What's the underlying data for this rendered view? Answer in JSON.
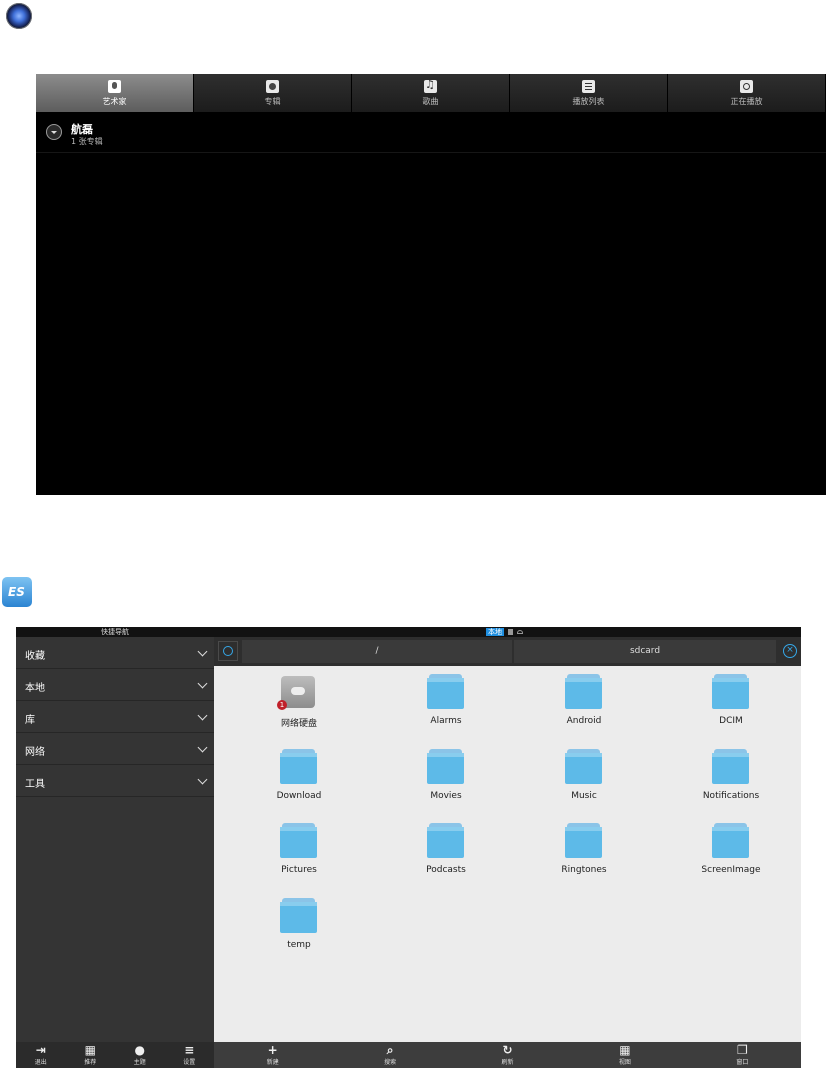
{
  "music_player": {
    "tabs": [
      {
        "label": "艺术家",
        "icon": "mic-icon",
        "active": true
      },
      {
        "label": "专辑",
        "icon": "album-icon"
      },
      {
        "label": "歌曲",
        "icon": "note-icon"
      },
      {
        "label": "播放列表",
        "icon": "list-icon"
      },
      {
        "label": "正在播放",
        "icon": "nowplaying-icon"
      }
    ],
    "artist": {
      "name": "航磊",
      "subtitle": "1 张专辑"
    }
  },
  "file_explorer": {
    "quicknav_title": "快捷导航",
    "status_local": "本地",
    "sidebar": [
      {
        "label": "收藏"
      },
      {
        "label": "本地"
      },
      {
        "label": "库"
      },
      {
        "label": "网络"
      },
      {
        "label": "工具"
      }
    ],
    "path": {
      "root": "/",
      "current": "sdcard"
    },
    "files": [
      {
        "name": "网络硬盘",
        "type": "cloud",
        "badge": "1"
      },
      {
        "name": "Alarms",
        "type": "folder"
      },
      {
        "name": "Android",
        "type": "folder"
      },
      {
        "name": "DCIM",
        "type": "folder"
      },
      {
        "name": "Download",
        "type": "folder"
      },
      {
        "name": "Movies",
        "type": "folder"
      },
      {
        "name": "Music",
        "type": "folder"
      },
      {
        "name": "Notifications",
        "type": "folder"
      },
      {
        "name": "Pictures",
        "type": "folder"
      },
      {
        "name": "Podcasts",
        "type": "folder"
      },
      {
        "name": "Ringtones",
        "type": "folder"
      },
      {
        "name": "ScreenImage",
        "type": "folder"
      },
      {
        "name": "temp",
        "type": "folder"
      }
    ],
    "side_toolbar": [
      {
        "label": "退出",
        "icon": "exit-icon"
      },
      {
        "label": "推荐",
        "icon": "gift-icon"
      },
      {
        "label": "主题",
        "icon": "theme-icon"
      },
      {
        "label": "设置",
        "icon": "settings-icon"
      }
    ],
    "main_toolbar": [
      {
        "label": "新建",
        "icon": "plus-icon"
      },
      {
        "label": "搜索",
        "icon": "search-icon"
      },
      {
        "label": "刷新",
        "icon": "refresh-icon"
      },
      {
        "label": "视图",
        "icon": "grid-view-icon"
      },
      {
        "label": "窗口",
        "icon": "windows-icon"
      }
    ]
  }
}
